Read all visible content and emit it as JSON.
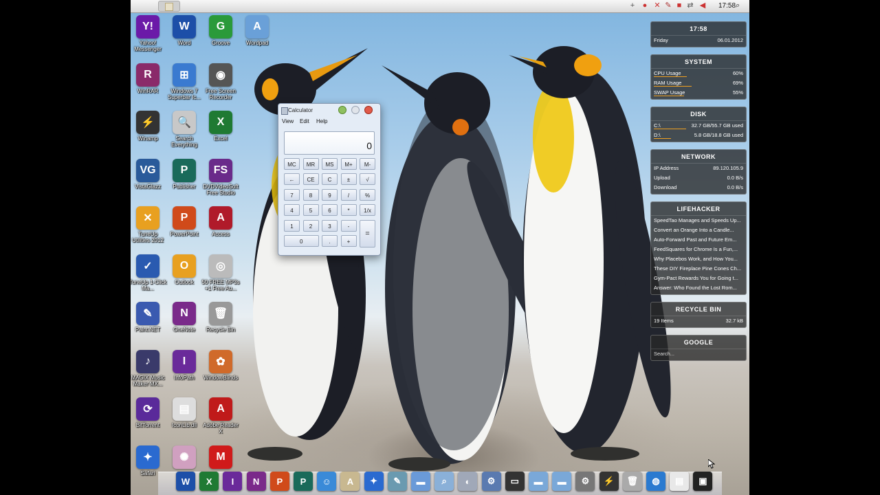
{
  "menubar": {
    "apple": "",
    "clock": "17:58"
  },
  "desktop_icons": [
    {
      "label": "Yahoo! Messenger",
      "icon": "yahoo-messenger-icon",
      "glyph": "Y!",
      "color": "#6b1aa8"
    },
    {
      "label": "Word",
      "icon": "word-icon",
      "glyph": "W",
      "color": "#1d4fa8"
    },
    {
      "label": "Groove",
      "icon": "groove-icon",
      "glyph": "G",
      "color": "#2a9a3a"
    },
    {
      "label": "Wordpad",
      "icon": "wordpad-icon",
      "glyph": "A",
      "color": "#6aa0d8"
    },
    {
      "label": "WinRAR",
      "icon": "winrar-icon",
      "glyph": "R",
      "color": "#8a2a6a"
    },
    {
      "label": "Windows 7 Superbar Ic...",
      "icon": "windows-superbar-icon",
      "glyph": "⊞",
      "color": "#3a7ad0"
    },
    {
      "label": "Free Screen Recorder",
      "icon": "screen-recorder-icon",
      "glyph": "◉",
      "color": "#555"
    },
    {
      "label": "Winamp",
      "icon": "winamp-icon",
      "glyph": "⚡",
      "color": "#333"
    },
    {
      "label": "Search Everything",
      "icon": "search-everything-icon",
      "glyph": "🔍",
      "color": "#c8c8c8"
    },
    {
      "label": "Excel",
      "icon": "excel-icon",
      "glyph": "X",
      "color": "#1f7a33"
    },
    {
      "label": "VistaGlazz",
      "icon": "vistaglazz-icon",
      "glyph": "VG",
      "color": "#2a5a9a"
    },
    {
      "label": "Publisher",
      "icon": "publisher-icon",
      "glyph": "P",
      "color": "#1a6a5a"
    },
    {
      "label": "DVDVideoSoft Free Studio",
      "icon": "dvdvideosoft-icon",
      "glyph": "FS",
      "color": "#6a2a8a"
    },
    {
      "label": "TuneUp Utilities 2012",
      "icon": "tuneup-icon",
      "glyph": "✕",
      "color": "#e8a020"
    },
    {
      "label": "PowerPoint",
      "icon": "powerpoint-icon",
      "glyph": "P",
      "color": "#d04a1a"
    },
    {
      "label": "Access",
      "icon": "access-icon",
      "glyph": "A",
      "color": "#b01a2a"
    },
    {
      "label": "TuneUp 1-Click Ma...",
      "icon": "tuneup-1click-icon",
      "glyph": "✓",
      "color": "#2a5ab0"
    },
    {
      "label": "Outlook",
      "icon": "outlook-icon",
      "glyph": "O",
      "color": "#e8a020"
    },
    {
      "label": "50 FREE MP3s +1 Free Au...",
      "icon": "mp3-icon",
      "glyph": "◎",
      "color": "#bbb"
    },
    {
      "label": "Paint.NET",
      "icon": "paint-net-icon",
      "glyph": "✎",
      "color": "#3a5ab0"
    },
    {
      "label": "OneNote",
      "icon": "onenote-icon",
      "glyph": "N",
      "color": "#7a2a8a"
    },
    {
      "label": "Recycle Bin",
      "icon": "recycle-bin-icon",
      "glyph": "🗑",
      "color": "#999"
    },
    {
      "label": "MAGIX Music Maker MX...",
      "icon": "magix-icon",
      "glyph": "♪",
      "color": "#3a3a6a"
    },
    {
      "label": "InfoPath",
      "icon": "infopath-icon",
      "glyph": "I",
      "color": "#6a2a9a"
    },
    {
      "label": "WindowBlinds",
      "icon": "windowblinds-icon",
      "glyph": "✿",
      "color": "#d06a2a"
    },
    {
      "label": "BitTorrent",
      "icon": "bittorrent-icon",
      "glyph": "⟳",
      "color": "#5a2a9a"
    },
    {
      "label": "IconLib.dll",
      "icon": "iconlib-icon",
      "glyph": "▤",
      "color": "#ddd"
    },
    {
      "label": "Adobe Reader X",
      "icon": "adobe-reader-icon",
      "glyph": "A",
      "color": "#c01a1a"
    },
    {
      "label": "Safari",
      "icon": "safari-icon",
      "glyph": "✦",
      "color": "#2a6ad0"
    },
    {
      "label": "",
      "icon": "colorful-app-icon",
      "glyph": "✺",
      "color": "#d0a0c0"
    },
    {
      "label": "",
      "icon": "mcafee-icon",
      "glyph": "M",
      "color": "#d01a1a"
    }
  ],
  "widgets": {
    "clock": {
      "time": "17:58",
      "day": "Friday",
      "date": "06.01.2012"
    },
    "system": {
      "title": "SYSTEM",
      "rows": [
        {
          "label": "CPU Usage",
          "value": "60%",
          "fill": 0.6
        },
        {
          "label": "RAM Usage",
          "value": "69%",
          "fill": 0.69
        },
        {
          "label": "SWAP Usage",
          "value": "55%",
          "fill": 0.55
        }
      ]
    },
    "disk": {
      "title": "DISK",
      "rows": [
        {
          "label": "C:\\",
          "value": "32.7 GB/55.7 GB used",
          "fill": 0.59
        },
        {
          "label": "D:\\",
          "value": "5.8 GB/18.8 GB used",
          "fill": 0.31
        }
      ]
    },
    "network": {
      "title": "NETWORK",
      "rows": [
        {
          "label": "IP Address",
          "value": "89.120.105.9"
        },
        {
          "label": "Upload",
          "value": "0.0 B/s"
        },
        {
          "label": "Download",
          "value": "0.0 B/s"
        }
      ]
    },
    "lifehacker": {
      "title": "LIFEHACKER",
      "items": [
        "SpeedTao Manages and Speeds Up...",
        "Convert an Orange Into a Candle...",
        "Auto-Forward Past and Future Em...",
        "FeedSquares for Chrome Is a Fun,...",
        "Why Placebos Work, and How You...",
        "These DIY Fireplace Pine Cones Ch...",
        "Gym-Pact Rewards You for Going t...",
        "Answer: Who Found the Lost Rom..."
      ]
    },
    "recycle": {
      "title": "RECYCLE BIN",
      "items_label": "19 Items",
      "size": "32.7 kB"
    },
    "google": {
      "title": "GOOGLE",
      "placeholder": "Search..."
    }
  },
  "calculator": {
    "title": "Calculator",
    "menu": [
      "View",
      "Edit",
      "Help"
    ],
    "display": "0",
    "buttons": [
      [
        "MC",
        "MR",
        "MS",
        "M+",
        "M-"
      ],
      [
        "←",
        "CE",
        "C",
        "±",
        "√"
      ],
      [
        "7",
        "8",
        "9",
        "/",
        "%"
      ],
      [
        "4",
        "5",
        "6",
        "*",
        "1/x"
      ],
      [
        "1",
        "2",
        "3",
        "-",
        "="
      ],
      [
        "0",
        ".",
        "+"
      ]
    ]
  },
  "dock": [
    {
      "icon": "word-dock-icon",
      "glyph": "W",
      "color": "#1d4fa8"
    },
    {
      "icon": "excel-dock-icon",
      "glyph": "X",
      "color": "#1f7a33"
    },
    {
      "icon": "infopath-dock-icon",
      "glyph": "I",
      "color": "#6a2a9a"
    },
    {
      "icon": "onenote-dock-icon",
      "glyph": "N",
      "color": "#7a2a8a"
    },
    {
      "icon": "powerpoint-dock-icon",
      "glyph": "P",
      "color": "#d04a1a"
    },
    {
      "icon": "publisher-dock-icon",
      "glyph": "P",
      "color": "#1a6a5a"
    },
    {
      "icon": "finder-dock-icon",
      "glyph": "☺",
      "color": "#3a8ad8"
    },
    {
      "icon": "textedit-dock-icon",
      "glyph": "A",
      "color": "#c8b890"
    },
    {
      "icon": "safari-dock-icon",
      "glyph": "✦",
      "color": "#2a6ad0"
    },
    {
      "icon": "brush-dock-icon",
      "glyph": "✎",
      "color": "#6a9ab0"
    },
    {
      "icon": "folder-dock-icon",
      "glyph": "▬",
      "color": "#6a9ad8"
    },
    {
      "icon": "search-dock-icon",
      "glyph": "⌕",
      "color": "#8ab0d8"
    },
    {
      "icon": "network-dock-icon",
      "glyph": "◐",
      "color": "#a0a8b8"
    },
    {
      "icon": "settings-dock-icon",
      "glyph": "⚙",
      "color": "#5a7ab0"
    },
    {
      "icon": "terminal-dock-icon",
      "glyph": "▭",
      "color": "#333"
    },
    {
      "icon": "folder2-dock-icon",
      "glyph": "▬",
      "color": "#7aa8d8"
    },
    {
      "icon": "folder3-dock-icon",
      "glyph": "▬",
      "color": "#7aa8d8"
    },
    {
      "icon": "system-prefs-dock-icon",
      "glyph": "⚙",
      "color": "#777"
    },
    {
      "icon": "winamp-dock-icon",
      "glyph": "⚡",
      "color": "#333"
    },
    {
      "icon": "trash-dock-icon",
      "glyph": "🗑",
      "color": "#aaa"
    },
    {
      "icon": "globe-dock-icon",
      "glyph": "◍",
      "color": "#2a7ad0"
    },
    {
      "icon": "document-dock-icon",
      "glyph": "▤",
      "color": "#e8e8e8"
    },
    {
      "icon": "screen-dock-icon",
      "glyph": "▣",
      "color": "#222"
    }
  ]
}
